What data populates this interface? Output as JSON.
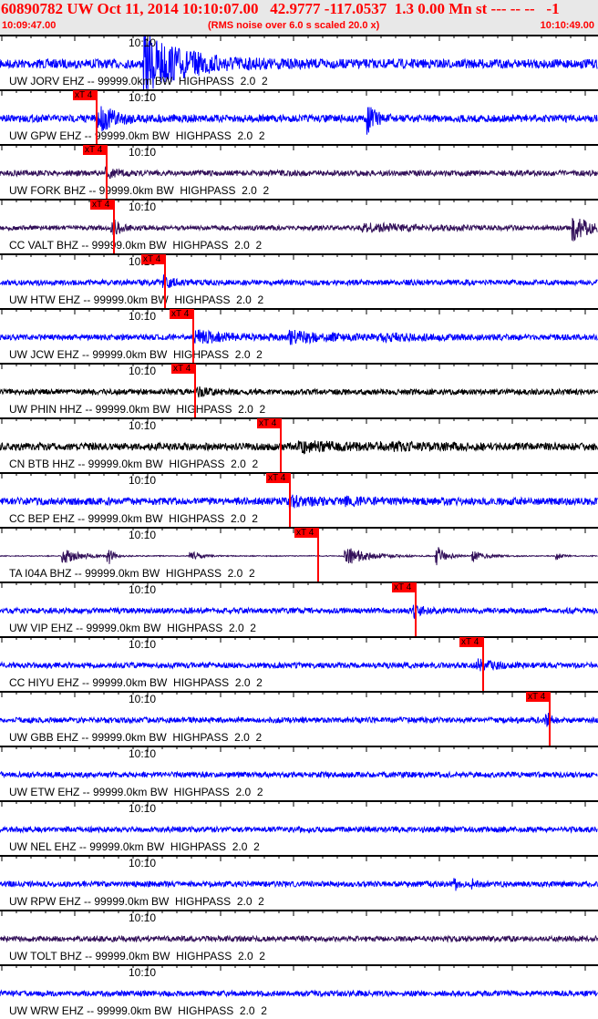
{
  "header": {
    "title": "60890782 UW Oct 11, 2014 10:10:07.00   42.9777 -117.0537  1.3 0.00 Mn st --- -- --   -1",
    "start_time": "10:09:47.00",
    "note": "(RMS noise over 6.0 s scaled 20.0 x)",
    "end_time": "10:10:49.00"
  },
  "tick_label": "10:10",
  "pick_label": "xT 4",
  "colors": {
    "blue": "#0000ff",
    "black": "#000000",
    "purple": "#33115a",
    "pick": "#ff0000"
  },
  "traces": [
    {
      "label": "UW JORV EHZ -- 99999.0km BW  HIGHPASS  2.0  2",
      "color": "blue"
    },
    {
      "label": "UW GPW EHZ -- 99999.0km BW  HIGHPASS  2.0  2",
      "color": "blue"
    },
    {
      "label": "UW FORK BHZ -- 99999.0km BW  HIGHPASS  2.0  2",
      "color": "purple"
    },
    {
      "label": "CC VALT BHZ -- 99999.0km BW  HIGHPASS  2.0  2",
      "color": "purple"
    },
    {
      "label": "UW HTW EHZ -- 99999.0km BW  HIGHPASS  2.0  2",
      "color": "blue"
    },
    {
      "label": "UW JCW EHZ -- 99999.0km BW  HIGHPASS  2.0  2",
      "color": "blue"
    },
    {
      "label": "UW PHIN HHZ -- 99999.0km BW  HIGHPASS  2.0  2",
      "color": "black"
    },
    {
      "label": "CN BTB HHZ -- 99999.0km BW  HIGHPASS  2.0  2",
      "color": "black"
    },
    {
      "label": "CC BEP EHZ -- 99999.0km BW  HIGHPASS  2.0  2",
      "color": "blue"
    },
    {
      "label": "TA I04A BHZ -- 99999.0km BW  HIGHPASS  2.0  2",
      "color": "purple"
    },
    {
      "label": "UW VIP EHZ -- 99999.0km BW  HIGHPASS  2.0  2",
      "color": "blue"
    },
    {
      "label": "CC HIYU EHZ -- 99999.0km BW  HIGHPASS  2.0  2",
      "color": "blue"
    },
    {
      "label": "UW GBB EHZ -- 99999.0km BW  HIGHPASS  2.0  2",
      "color": "blue"
    },
    {
      "label": "UW ETW EHZ -- 99999.0km BW  HIGHPASS  2.0  2",
      "color": "blue"
    },
    {
      "label": "UW NEL EHZ -- 99999.0km BW  HIGHPASS  2.0  2",
      "color": "blue"
    },
    {
      "label": "UW RPW EHZ -- 99999.0km BW  HIGHPASS  2.0  2",
      "color": "blue"
    },
    {
      "label": "UW TOLT BHZ -- 99999.0km BW  HIGHPASS  2.0  2",
      "color": "purple"
    },
    {
      "label": "UW WRW EHZ -- 99999.0km BW  HIGHPASS  2.0  2",
      "color": "blue"
    }
  ]
}
